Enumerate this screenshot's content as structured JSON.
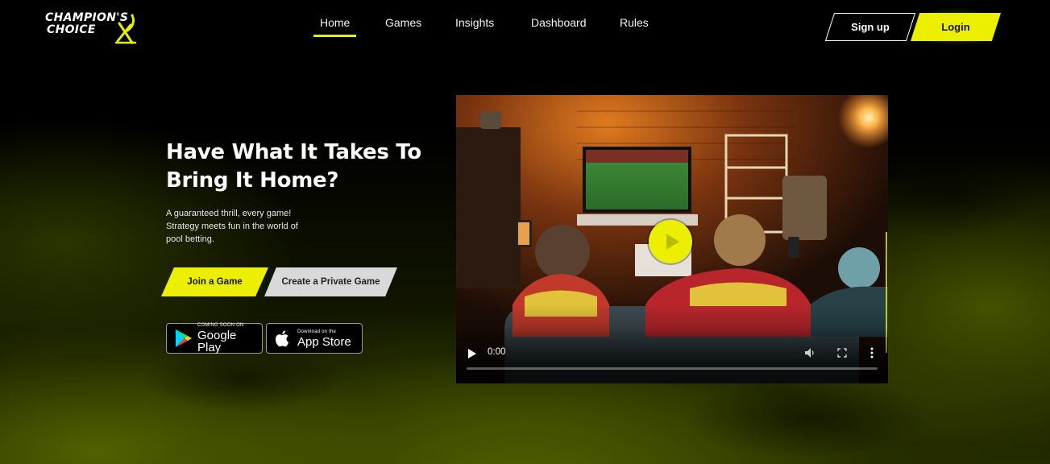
{
  "brand": {
    "line1": "Champion's",
    "line2": "Choice"
  },
  "nav": {
    "items": [
      {
        "label": "Home",
        "active": true
      },
      {
        "label": "Games",
        "active": false
      },
      {
        "label": "Insights",
        "active": false
      },
      {
        "label": "Dashboard",
        "active": false
      },
      {
        "label": "Rules",
        "active": false
      }
    ]
  },
  "auth": {
    "signup_label": "Sign up",
    "login_label": "Login"
  },
  "hero": {
    "title_line1": "Have What It Takes To",
    "title_line2": "Bring It Home?",
    "subtitle_line1": "A guaranteed thrill, every game!",
    "subtitle_line2": "Strategy meets fun in the world of",
    "subtitle_line3": "pool betting.",
    "join_label": "Join a Game",
    "private_label": "Create a Private Game"
  },
  "stores": {
    "google_small": "COMING SOON ON",
    "google_big": "Google Play",
    "apple_small": "Download on the",
    "apple_big": "App Store"
  },
  "video": {
    "time": "0:00",
    "progress": 0
  },
  "colors": {
    "accent": "#ECF000",
    "background": "#000000",
    "secondary_button": "#D9D9D9"
  },
  "icons": {
    "play": "play-icon",
    "volume": "volume-icon",
    "fullscreen": "fullscreen-icon",
    "more": "more-vertical-icon",
    "google_play": "google-play-icon",
    "apple": "apple-icon"
  }
}
